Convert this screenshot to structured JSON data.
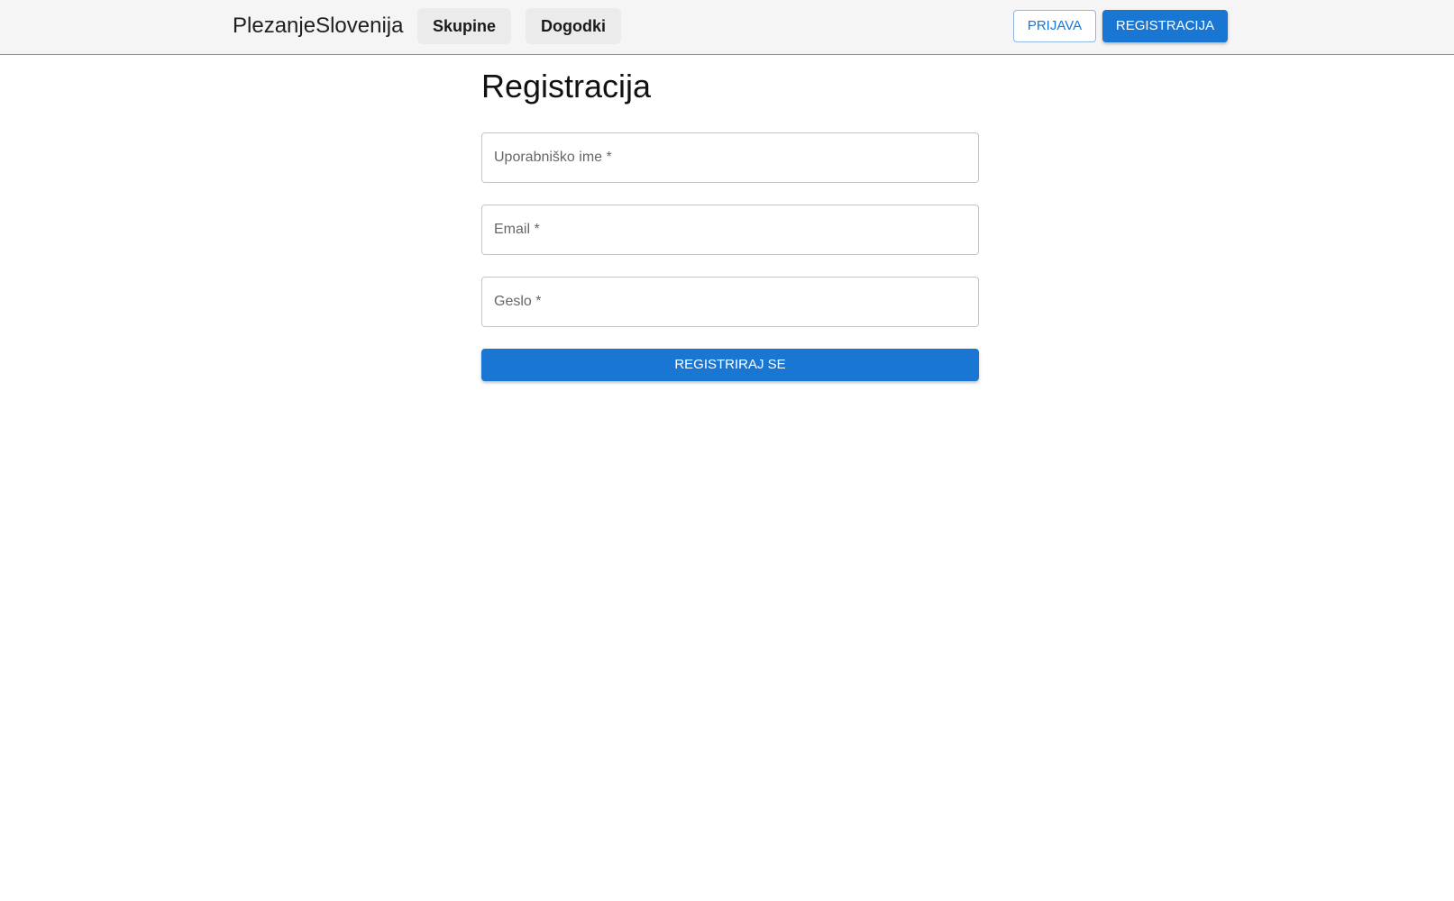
{
  "navbar": {
    "brand": "PlezanjeSlovenija",
    "links": [
      {
        "label": "Skupine"
      },
      {
        "label": "Dogodki"
      }
    ],
    "login_label": "PRIJAVA",
    "register_label": "REGISTRACIJA"
  },
  "main": {
    "title": "Registracija",
    "fields": {
      "username_label": "Uporabniško ime *",
      "email_label": "Email *",
      "password_label": "Geslo *"
    },
    "submit_label": "REGISTRIRAJ SE"
  },
  "colors": {
    "primary": "#1976d2",
    "navbar_bg": "#f5f5f5"
  }
}
